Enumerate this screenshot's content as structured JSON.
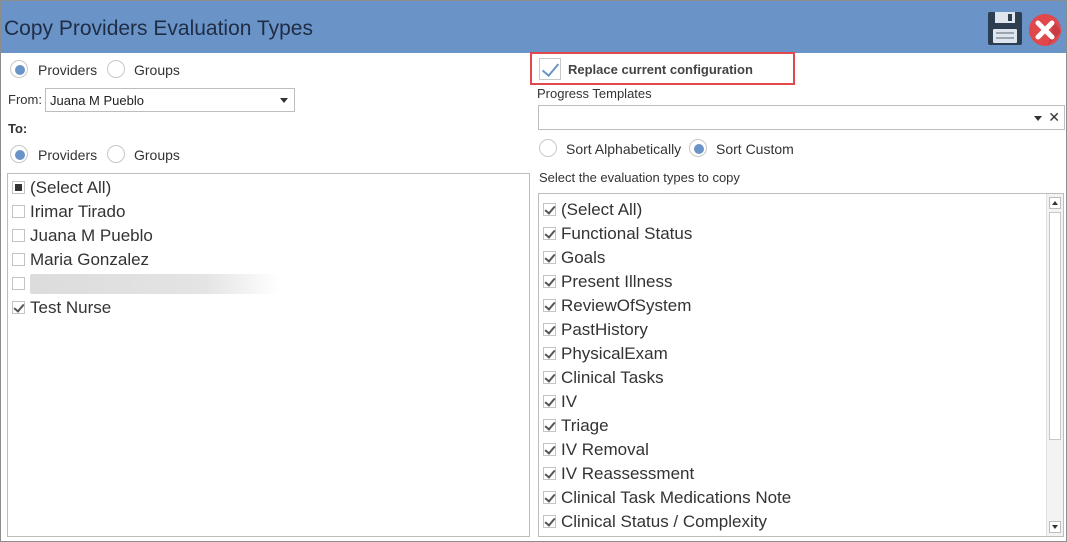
{
  "window": {
    "title": "Copy Providers Evaluation Types"
  },
  "toolbar": {
    "save_icon": "floppy-disk-icon",
    "close_icon": "close-x-icon",
    "close_color": "#e0484b"
  },
  "source": {
    "type_options": [
      {
        "label": "Providers",
        "selected": true
      },
      {
        "label": "Groups",
        "selected": false
      }
    ],
    "from_label": "From:",
    "from_value": "Juana M Pueblo"
  },
  "target": {
    "to_label": "To:",
    "type_options": [
      {
        "label": "Providers",
        "selected": true
      },
      {
        "label": "Groups",
        "selected": false
      }
    ],
    "items": [
      {
        "label": "(Select All)",
        "state": "partial"
      },
      {
        "label": "Irimar Tirado",
        "state": "unchecked"
      },
      {
        "label": "Juana M Pueblo",
        "state": "unchecked"
      },
      {
        "label": "Maria Gonzalez",
        "state": "unchecked"
      },
      {
        "label": "",
        "state": "unchecked",
        "redacted": true
      },
      {
        "label": "Test Nurse",
        "state": "checked"
      }
    ]
  },
  "options": {
    "replace_label": "Replace current configuration",
    "replace_checked": true,
    "progress_templates_label": "Progress Templates",
    "progress_templates_value": "",
    "clear_glyph": "✕",
    "sort_options": [
      {
        "label": "Sort Alphabetically",
        "selected": false
      },
      {
        "label": "Sort Custom",
        "selected": true
      }
    ],
    "eval_label": "Select the evaluation types to copy",
    "eval_types": [
      "(Select All)",
      "Functional Status",
      "Goals",
      "Present Illness",
      "ReviewOfSystem",
      "PastHistory",
      "PhysicalExam",
      "Clinical Tasks",
      "IV",
      "Triage",
      "IV Removal",
      "IV Reassessment",
      "Clinical Task Medications Note",
      "Clinical Status / Complexity"
    ]
  },
  "colors": {
    "titlebar": "#6a93c8",
    "highlight_border": "#e0484b"
  }
}
